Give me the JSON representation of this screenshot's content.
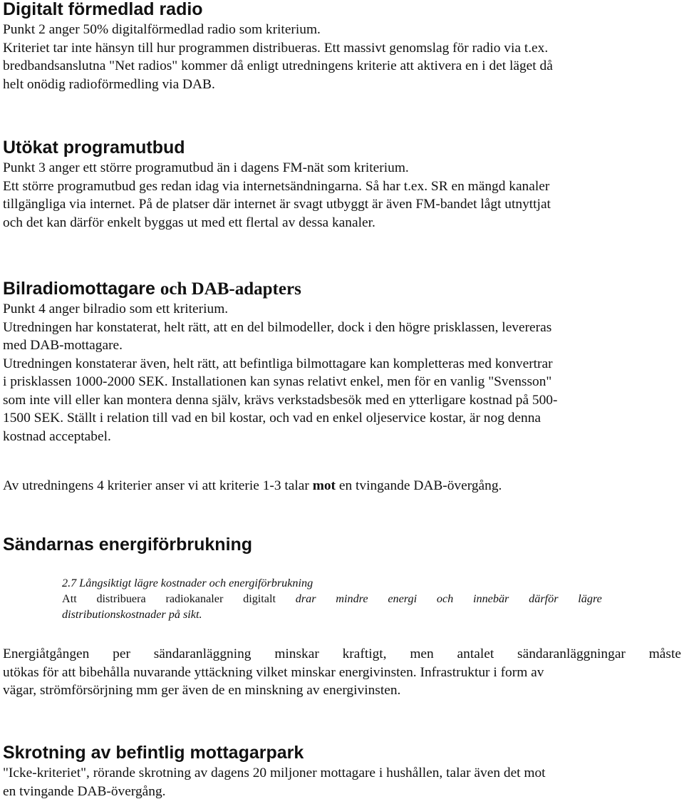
{
  "sections": {
    "digital": {
      "heading": "Digitalt förmedlad radio",
      "lines": [
        "Punkt 2 anger 50% digitalförmedlad radio som kriterium.",
        "Kriteriet tar inte hänsyn till hur programmen distribueras. Ett massivt genomslag för radio via t.ex.",
        "bredbandsanslutna \"Net radios\" kommer då enligt utredningens kriterie att aktivera en i det läget då",
        "helt onödig radioförmedling via DAB."
      ]
    },
    "programutbud": {
      "heading": "Utökat programutbud",
      "lines": [
        "Punkt 3 anger ett större programutbud än i dagens FM-nät som kriterium.",
        "Ett större programutbud ges redan idag via internetsändningarna. Så har t.ex. SR en mängd kanaler",
        "tillgängliga via internet. På de platser där internet är svagt utbyggt är även FM-bandet lågt utnyttjat",
        "och det kan därför enkelt byggas ut med ett flertal av dessa kanaler."
      ]
    },
    "bilradio": {
      "heading_sans": "Bilradiomottagare",
      "heading_serif": "och DAB-adapters",
      "lines": [
        "Punkt 4 anger bilradio som ett kriterium.",
        "Utredningen har konstaterat, helt rätt, att en del bilmodeller, dock i den högre prisklassen, levereras",
        "med DAB-mottagare.",
        "Utredningen konstaterar även, helt rätt, att befintliga bilmottagare kan kompletteras med konvertrar",
        "i prisklassen 1000-2000 SEK. Installationen kan synas relativt enkel, men för en vanlig \"Svensson\"",
        "som inte vill eller kan montera denna själv, krävs verkstadsbesök med en ytterligare kostnad på 500-",
        "1500 SEK. Ställt i relation till vad en bil kostar, och vad en enkel oljeservice kostar, är nog denna",
        "kostnad acceptabel."
      ],
      "conclusion_before": "Av utredningens 4 kriterier anser vi att kriterie 1-3 talar ",
      "conclusion_bold": "mot",
      "conclusion_after": " en tvingande DAB-övergång."
    },
    "energi": {
      "heading": "Sändarnas energiförbrukning",
      "quote": {
        "title": "2.7 Långsiktigt lägre kostnader och energiförbrukning",
        "line2_words_regular": [
          "Att",
          "distribuera",
          "radiokanaler",
          "digitalt"
        ],
        "line2_words_italic": [
          "drar",
          "mindre",
          "energi",
          "och",
          "innebär",
          "därför",
          "lägre"
        ],
        "line3": "distributionskostnader på sikt."
      },
      "line1_words": [
        "Energiåtgången",
        "per",
        "sändaranläggning",
        "minskar",
        "kraftigt,",
        "men",
        "antalet",
        "sändaranläggningar",
        "måste"
      ],
      "line2": "utökas för att bibehålla nuvarande yttäckning vilket minskar energivinsten. Infrastruktur i form av",
      "line3": "vägar, strömförsörjning mm ger även de en minskning av energivinsten."
    },
    "skrotning": {
      "heading": "Skrotning av befintlig mottagarpark",
      "lines": [
        "\"Icke-kriteriet\", rörande skrotning av dagens 20 miljoner mottagare i hushållen, talar även det mot",
        "en tvingande DAB-övergång."
      ]
    }
  }
}
